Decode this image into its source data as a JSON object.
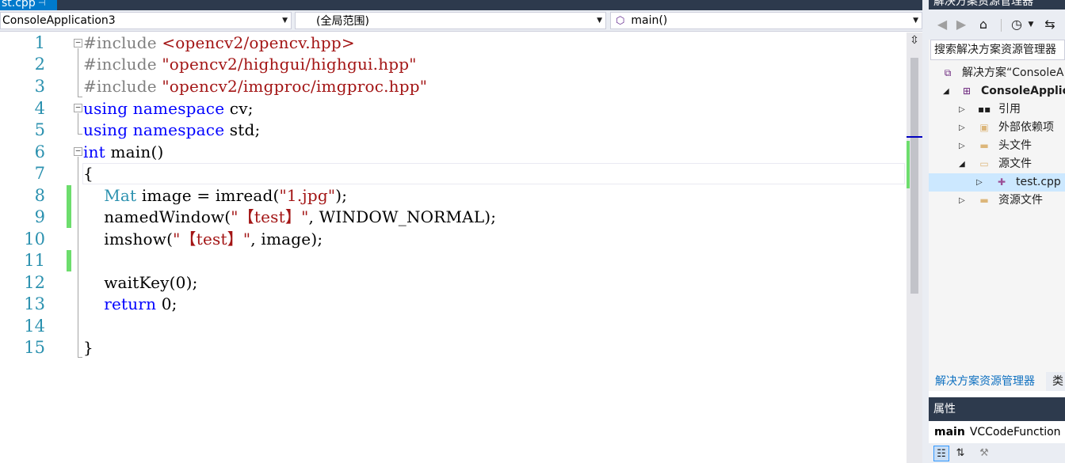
{
  "editor_tab": {
    "label": "st.cpp",
    "pin": "⊣",
    "close": "×"
  },
  "navigation": {
    "project": "ConsoleApplication3",
    "scope": "(全局范围)",
    "member": "main()"
  },
  "code_lines": [
    {
      "num": "1"
    },
    {
      "num": "2"
    },
    {
      "num": "3"
    },
    {
      "num": "4"
    },
    {
      "num": "5"
    },
    {
      "num": "6"
    },
    {
      "num": "7"
    },
    {
      "num": "8"
    },
    {
      "num": "9"
    },
    {
      "num": "10"
    },
    {
      "num": "11"
    },
    {
      "num": "12"
    },
    {
      "num": "13"
    },
    {
      "num": "14"
    },
    {
      "num": "15"
    }
  ],
  "code": {
    "l1_a": "#include ",
    "l1_b": "<opencv2/opencv.hpp>",
    "l2_a": "#include ",
    "l2_b": "\"opencv2/highgui/highgui.hpp\"",
    "l3_a": "#include ",
    "l3_b": "\"opencv2/imgproc/imgproc.hpp\"",
    "l4_a": "using",
    "l4_b": " ",
    "l4_c": "namespace",
    "l4_d": " cv;",
    "l5_a": "using",
    "l5_b": " ",
    "l5_c": "namespace",
    "l5_d": " std;",
    "l6_a": "int",
    "l6_b": " main()",
    "l7": "{",
    "l8_a": "    ",
    "l8_b": "Mat",
    "l8_c": " image = imread(",
    "l8_d": "\"1.jpg\"",
    "l8_e": ");",
    "l9_a": "    namedWindow(",
    "l9_b": "\"【test】\"",
    "l9_c": ", WINDOW_NORMAL);",
    "l10_a": "    imshow(",
    "l10_b": "\"【test】\"",
    "l10_c": ", image);",
    "l12": "    waitKey(0);",
    "l13_a": "    ",
    "l13_b": "return",
    "l13_c": " 0;",
    "l15": "}"
  },
  "solution_explorer": {
    "title": "解决方案资源管理器",
    "search_placeholder": "搜索解决方案资源管理器",
    "items": [
      {
        "label": "解决方案“ConsoleA",
        "icon": "solution-icon"
      },
      {
        "label": "ConsoleApplic",
        "icon": "project-icon"
      },
      {
        "label": "引用",
        "icon": "references-icon"
      },
      {
        "label": "外部依赖项",
        "icon": "external-deps-icon"
      },
      {
        "label": "头文件",
        "icon": "folder-icon"
      },
      {
        "label": "源文件",
        "icon": "folder-open-icon"
      },
      {
        "label": "test.cpp",
        "icon": "cpp-file-icon"
      },
      {
        "label": "资源文件",
        "icon": "folder-icon"
      }
    ],
    "bottom_tabs": [
      "解决方案资源管理器",
      "类"
    ]
  },
  "properties": {
    "title": "属性",
    "object_name": "main",
    "object_type": "VCCodeFunction"
  },
  "colors": {
    "keyword": "#0000ff",
    "string": "#a31515",
    "preprocessor": "#808080",
    "type": "#2b91af",
    "line_number": "#2b91af",
    "change_marker": "#6ddd6d",
    "tab_active": "#007acc"
  }
}
